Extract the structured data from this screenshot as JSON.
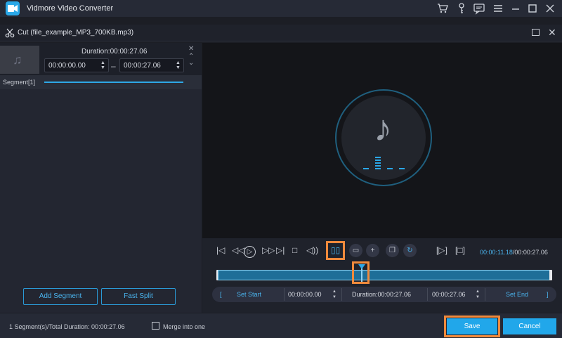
{
  "app": {
    "title": "Vidmore Video Converter"
  },
  "dialog": {
    "title": "Cut (file_example_MP3_700KB.mp3)"
  },
  "segment_panel": {
    "duration_label": "Duration:00:00:27.06",
    "start_time": "00:00:00.00",
    "end_time": "00:00:27.06",
    "separator": "–",
    "segment_label": "Segment[1]",
    "add_segment_label": "Add Segment",
    "fast_split_label": "Fast Split"
  },
  "player": {
    "current_time": "00:00:11.18",
    "total_time": "/00:00:27.06",
    "set_start_label": "Set Start",
    "set_end_label": "Set End",
    "start_value": "00:00:00.00",
    "duration_label": "Duration:00:00:27.06",
    "end_value": "00:00:27.06",
    "left_bracket": "[",
    "right_bracket": "]",
    "playhead_position": 0.432
  },
  "footer": {
    "summary": "1 Segment(s)/Total Duration: 00:00:27.06",
    "merge_label": "Merge into one",
    "merge_checked": false,
    "save_label": "Save",
    "cancel_label": "Cancel"
  },
  "colors": {
    "accent": "#21a7ea",
    "highlight": "#f08a3c",
    "background": "#1c1e25"
  },
  "icons": [
    "app-logo",
    "cart-icon",
    "key-icon",
    "chat-icon",
    "menu-icon",
    "minimize-icon",
    "maximize-icon",
    "close-icon",
    "scissors-icon",
    "music-note-icon",
    "equalizer-icon",
    "skip-start-icon",
    "step-back-icon",
    "play-icon",
    "step-forward-icon",
    "skip-end-icon",
    "stop-icon",
    "volume-icon",
    "split-icon",
    "delete-icon",
    "add-icon",
    "copy-icon",
    "reset-icon",
    "play-segment-icon",
    "select-segment-icon"
  ]
}
